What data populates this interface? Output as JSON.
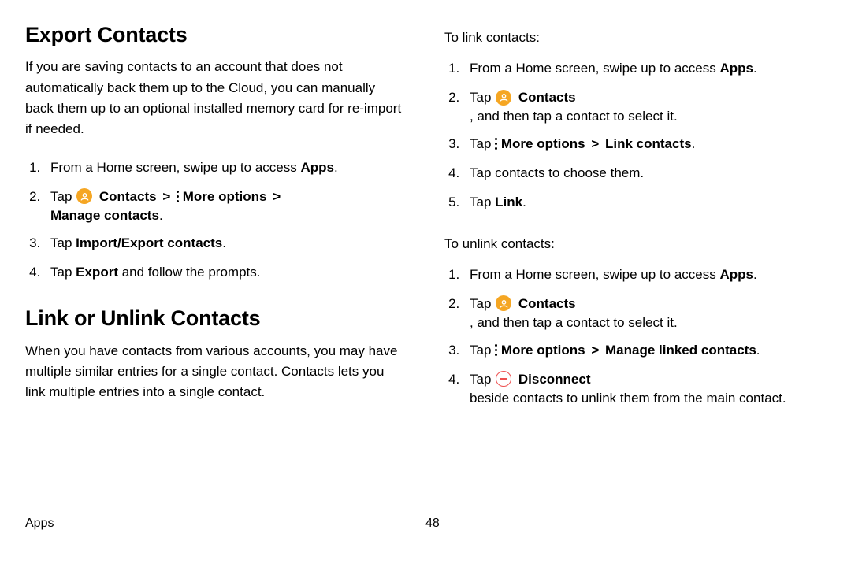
{
  "left": {
    "section1": {
      "heading": "Export Contacts",
      "desc": "If you are saving contacts to an account that does not automatically back them up to the Cloud, you can manually back them up to an optional installed memory card for re-import if needed.",
      "steps": {
        "s1a": "From a Home screen, swipe up to access ",
        "s1b": "Apps",
        "s1c": ".",
        "s2a": "Tap ",
        "s2b": "Contacts",
        "s2chev1": ">",
        "s2c": "More options",
        "s2chev2": ">",
        "s2d": "Manage contacts",
        "s2e": ".",
        "s3a": "Tap ",
        "s3b": "Import/Export contacts",
        "s3c": ".",
        "s4a": "Tap ",
        "s4b": "Export",
        "s4c": " and follow the prompts."
      }
    },
    "section2": {
      "heading": "Link or Unlink Contacts",
      "desc": "When you have contacts from various accounts, you may have multiple similar entries for a single contact. Contacts lets you link multiple entries into a single contact."
    }
  },
  "right": {
    "linkIntro": "To link contacts:",
    "link": {
      "s1a": "From a Home screen, swipe up to access ",
      "s1b": "Apps",
      "s1c": ".",
      "s2a": "Tap ",
      "s2b": "Contacts",
      "s2c": ", and then tap a contact to select it.",
      "s3a": "Tap ",
      "s3b": "More options",
      "s3chev": ">",
      "s3c": "Link contacts",
      "s3d": ".",
      "s4": "Tap contacts to choose them.",
      "s5a": "Tap ",
      "s5b": "Link",
      "s5c": "."
    },
    "unlinkIntro": "To unlink contacts:",
    "unlink": {
      "s1a": "From a Home screen, swipe up to access ",
      "s1b": "Apps",
      "s1c": ".",
      "s2a": "Tap ",
      "s2b": "Contacts",
      "s2c": ", and then tap a contact to select it.",
      "s3a": "Tap ",
      "s3b": "More options",
      "s3chev": ">",
      "s3c": "Manage linked contacts",
      "s3d": ".",
      "s4a": "Tap ",
      "s4b": "Disconnect",
      "s4c": " beside contacts to unlink them from the main contact."
    }
  },
  "footer": {
    "section": "Apps",
    "page": "48"
  }
}
